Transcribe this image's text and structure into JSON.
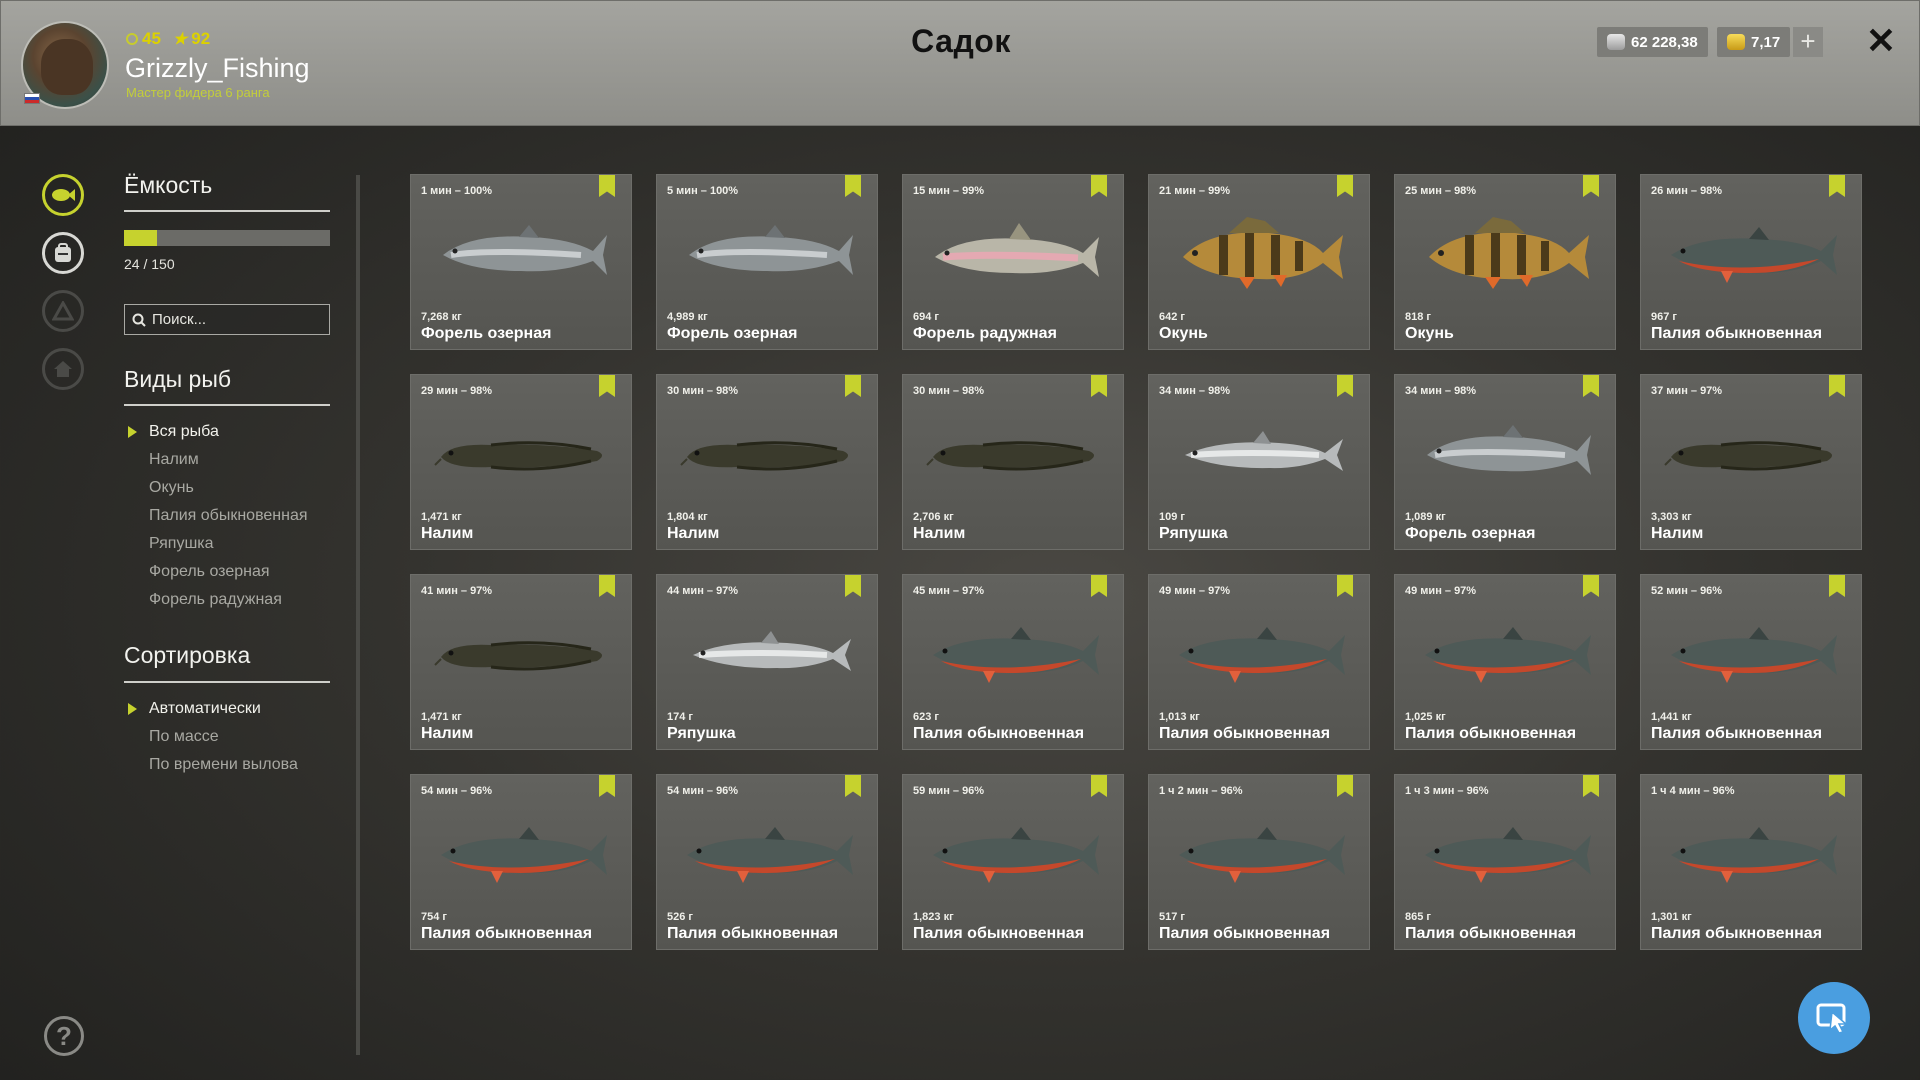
{
  "header": {
    "title": "Садок",
    "username": "Grizzly_Fishing",
    "rank": "Мастер фидера 6 ранга",
    "level_ring": "45",
    "level_star": "92",
    "silver": "62 228,38",
    "gold": "7,17",
    "plus": "+",
    "close": "✕"
  },
  "sidebar": {
    "capacity_title": "Ёмкость",
    "capacity_text": "24 / 150",
    "capacity_fraction": 0.16,
    "search_placeholder": "Поиск...",
    "species_title": "Виды рыб",
    "species": [
      "Вся рыба",
      "Налим",
      "Окунь",
      "Палия обыкновенная",
      "Ряпушка",
      "Форель озерная",
      "Форель радужная"
    ],
    "sort_title": "Сортировка",
    "sort": [
      "Автоматически",
      "По массе",
      "По времени вылова"
    ]
  },
  "help": "?",
  "colors": {
    "accent": "#c6d22e",
    "fab": "#4a9ee0"
  },
  "cards": [
    {
      "time": "1 мин – 100%",
      "weight": "7,268 кг",
      "name": "Форель озерная",
      "fish": "lake-trout"
    },
    {
      "time": "5 мин – 100%",
      "weight": "4,989 кг",
      "name": "Форель озерная",
      "fish": "lake-trout"
    },
    {
      "time": "15 мин – 99%",
      "weight": "694 г",
      "name": "Форель радужная",
      "fish": "rainbow-trout"
    },
    {
      "time": "21 мин – 99%",
      "weight": "642 г",
      "name": "Окунь",
      "fish": "perch"
    },
    {
      "time": "25 мин – 98%",
      "weight": "818 г",
      "name": "Окунь",
      "fish": "perch"
    },
    {
      "time": "26 мин – 98%",
      "weight": "967 г",
      "name": "Палия обыкновенная",
      "fish": "char"
    },
    {
      "time": "29 мин – 98%",
      "weight": "1,471 кг",
      "name": "Налим",
      "fish": "burbot"
    },
    {
      "time": "30 мин – 98%",
      "weight": "1,804 кг",
      "name": "Налим",
      "fish": "burbot"
    },
    {
      "time": "30 мин – 98%",
      "weight": "2,706 кг",
      "name": "Налим",
      "fish": "burbot"
    },
    {
      "time": "34 мин – 98%",
      "weight": "109 г",
      "name": "Ряпушка",
      "fish": "vendace"
    },
    {
      "time": "34 мин – 98%",
      "weight": "1,089 кг",
      "name": "Форель озерная",
      "fish": "lake-trout"
    },
    {
      "time": "37 мин – 97%",
      "weight": "3,303 кг",
      "name": "Налим",
      "fish": "burbot"
    },
    {
      "time": "41 мин – 97%",
      "weight": "1,471 кг",
      "name": "Налим",
      "fish": "burbot"
    },
    {
      "time": "44 мин – 97%",
      "weight": "174 г",
      "name": "Ряпушка",
      "fish": "vendace"
    },
    {
      "time": "45 мин – 97%",
      "weight": "623 г",
      "name": "Палия обыкновенная",
      "fish": "char"
    },
    {
      "time": "49 мин – 97%",
      "weight": "1,013 кг",
      "name": "Палия обыкновенная",
      "fish": "char"
    },
    {
      "time": "49 мин – 97%",
      "weight": "1,025 кг",
      "name": "Палия обыкновенная",
      "fish": "char"
    },
    {
      "time": "52 мин – 96%",
      "weight": "1,441 кг",
      "name": "Палия обыкновенная",
      "fish": "char"
    },
    {
      "time": "54 мин – 96%",
      "weight": "754 г",
      "name": "Палия обыкновенная",
      "fish": "char"
    },
    {
      "time": "54 мин – 96%",
      "weight": "526 г",
      "name": "Палия обыкновенная",
      "fish": "char"
    },
    {
      "time": "59 мин – 96%",
      "weight": "1,823 кг",
      "name": "Палия обыкновенная",
      "fish": "char"
    },
    {
      "time": "1 ч 2 мин – 96%",
      "weight": "517 г",
      "name": "Палия обыкновенная",
      "fish": "char"
    },
    {
      "time": "1 ч 3 мин – 96%",
      "weight": "865 г",
      "name": "Палия обыкновенная",
      "fish": "char"
    },
    {
      "time": "1 ч 4 мин – 96%",
      "weight": "1,301 кг",
      "name": "Палия обыкновенная",
      "fish": "char"
    }
  ]
}
